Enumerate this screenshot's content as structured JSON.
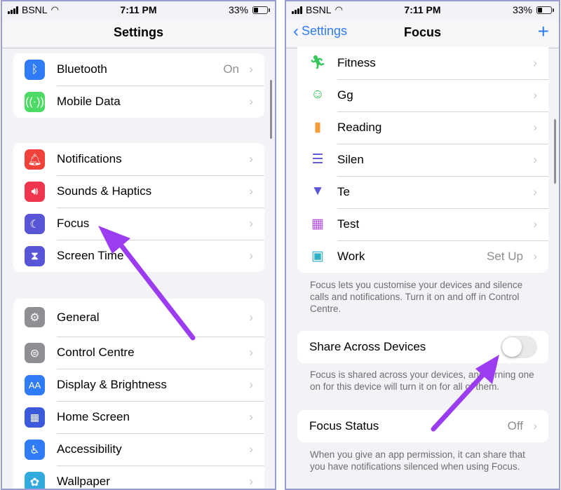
{
  "left": {
    "status": {
      "carrier": "BSNL",
      "time": "7:11 PM",
      "battery": "33%"
    },
    "nav": {
      "title": "Settings"
    },
    "group1": [
      {
        "label": "Bluetooth",
        "value": "On",
        "icon": "bluetooth-icon",
        "color": "#2f7cf6"
      },
      {
        "label": "Mobile Data",
        "value": "",
        "icon": "antenna-icon",
        "color": "#4cd964"
      }
    ],
    "group2": [
      {
        "label": "Notifications",
        "icon": "bell-icon",
        "color": "#f0413a"
      },
      {
        "label": "Sounds & Haptics",
        "icon": "speaker-icon",
        "color": "#f0364f"
      },
      {
        "label": "Focus",
        "icon": "moon-icon",
        "color": "#5856d6"
      },
      {
        "label": "Screen Time",
        "icon": "hourglass-icon",
        "color": "#5856d6"
      }
    ],
    "group3": [
      {
        "label": "General",
        "icon": "gear-icon",
        "color": "#8e8e93"
      },
      {
        "label": "Control Centre",
        "icon": "toggles-icon",
        "color": "#8e8e93"
      },
      {
        "label": "Display & Brightness",
        "icon": "text-size-icon",
        "color": "#2f7cf6"
      },
      {
        "label": "Home Screen",
        "icon": "app-grid-icon",
        "color": "#3b5bdb"
      },
      {
        "label": "Accessibility",
        "icon": "accessibility-icon",
        "color": "#2f7cf6"
      },
      {
        "label": "Wallpaper",
        "icon": "flower-icon",
        "color": "#33aadd"
      }
    ]
  },
  "right": {
    "status": {
      "carrier": "BSNL",
      "time": "7:11 PM",
      "battery": "33%"
    },
    "nav": {
      "back": "Settings",
      "title": "Focus",
      "add": "+"
    },
    "focus_list": [
      {
        "label": "Fitness",
        "icon": "running-icon",
        "color": "#34c759",
        "glyph": "🏃"
      },
      {
        "label": "Gg",
        "icon": "smiley-icon",
        "color": "#34c759",
        "glyph": "☺"
      },
      {
        "label": "Reading",
        "icon": "book-icon",
        "color": "#f29d38",
        "glyph": "▮"
      },
      {
        "label": "Silen",
        "icon": "list-icon",
        "color": "#5856d6",
        "glyph": "☰"
      },
      {
        "label": "Te",
        "icon": "bookmark-icon",
        "color": "#5856d6",
        "glyph": "▼"
      },
      {
        "label": "Test",
        "icon": "building-icon",
        "color": "#af52de",
        "glyph": "▦"
      },
      {
        "label": "Work",
        "value": "Set Up",
        "icon": "id-badge-icon",
        "color": "#30b0c7",
        "glyph": "▣"
      }
    ],
    "focus_note": "Focus lets you customise your devices and silence calls and notifications. Turn it on and off in Control Centre.",
    "share": {
      "label": "Share Across Devices",
      "enabled": false
    },
    "share_note": "Focus is shared across your devices, and turning one on for this device will turn it on for all of them.",
    "status_row": {
      "label": "Focus Status",
      "value": "Off"
    },
    "status_note": "When you give an app permission, it can share that you have notifications silenced when using Focus."
  },
  "accent": "#2f7cf6",
  "annotation_arrow_color": "#9b3cf0"
}
